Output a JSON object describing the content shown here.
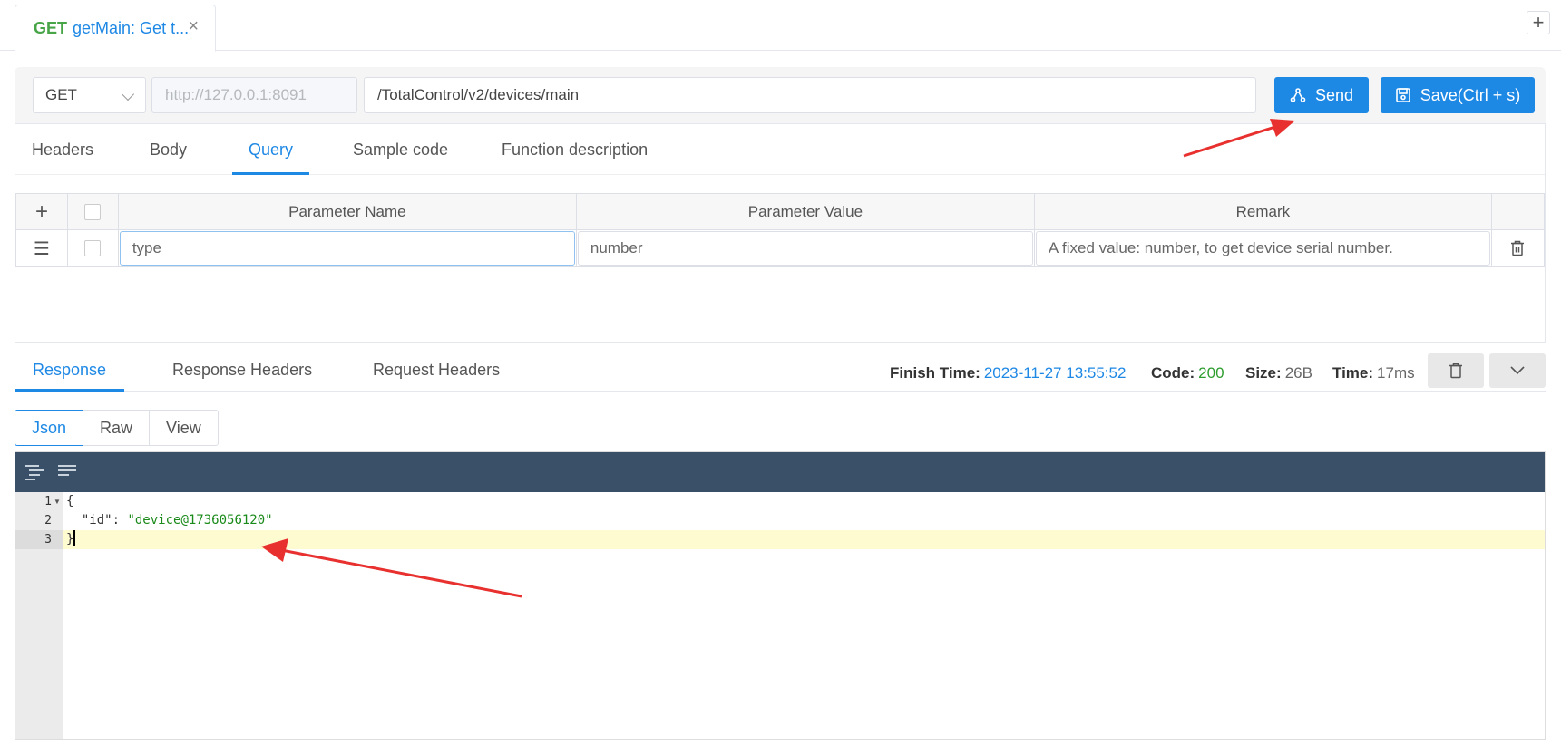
{
  "tab": {
    "method": "GET",
    "name": "getMain: Get t...",
    "close_glyph": "×",
    "add_glyph": "+"
  },
  "urlbar": {
    "method": "GET",
    "host": "http://127.0.0.1:8091",
    "path": "/TotalControl/v2/devices/main",
    "send_label": "Send",
    "save_label": "Save(Ctrl + s)"
  },
  "request_tabs": [
    "Headers",
    "Body",
    "Query",
    "Sample code",
    "Function description"
  ],
  "request_active_tab": "Query",
  "params": {
    "headers": [
      "Parameter Name",
      "Parameter Value",
      "Remark"
    ],
    "add_glyph": "+",
    "drag_glyph": "☰",
    "rows": [
      {
        "name": "type",
        "value": "number",
        "remark": "A fixed value: number, to get device serial number."
      }
    ]
  },
  "response": {
    "tabs": [
      "Response",
      "Response Headers",
      "Request Headers"
    ],
    "active_tab": "Response",
    "finish_time_label": "Finish Time:",
    "finish_time": "2023-11-27 13:55:52",
    "code_label": "Code:",
    "code": "200",
    "size_label": "Size:",
    "size": "26B",
    "time_label": "Time:",
    "time": "17ms",
    "views": [
      "Json",
      "Raw",
      "View"
    ],
    "active_view": "Json"
  },
  "editor": {
    "line_numbers": [
      "1",
      "2",
      "3"
    ],
    "lines": {
      "open": "{",
      "key": "\"id\"",
      "colon": ": ",
      "value": "\"device@1736056120\"",
      "close": "}"
    }
  },
  "colors": {
    "accent": "#1e88e5",
    "method_get": "#47a447",
    "toolbar": "#3a5068",
    "annotation": "#e8312f"
  }
}
